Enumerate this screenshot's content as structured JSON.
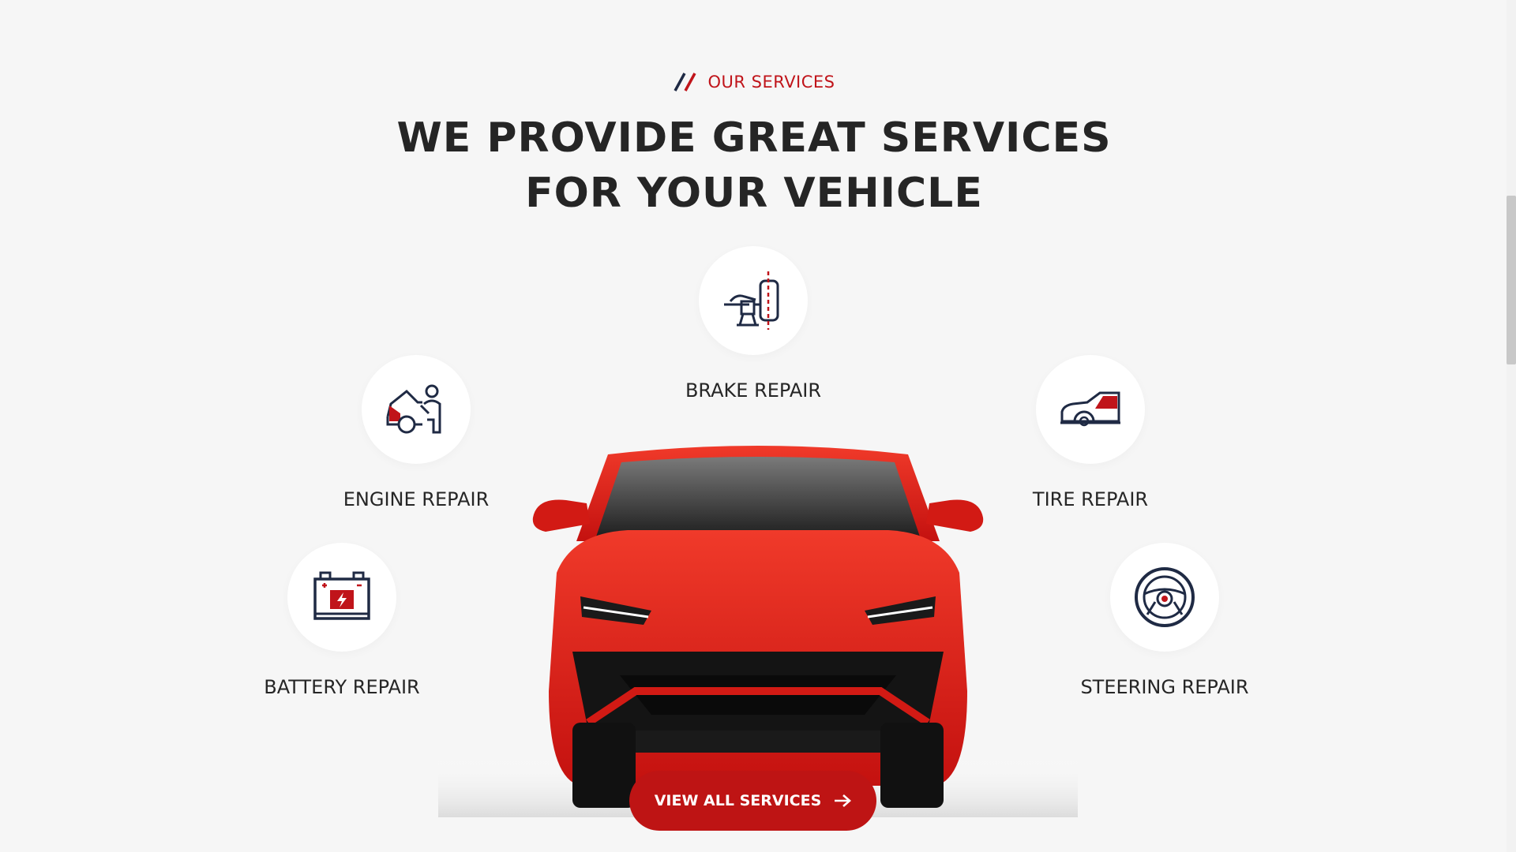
{
  "section": {
    "eyebrow": "OUR SERVICES",
    "title_line1": "WE PROVIDE GREAT SERVICES",
    "title_line2": "FOR YOUR VEHICLE"
  },
  "services": {
    "brake": {
      "label": "BRAKE REPAIR",
      "icon": "brake-icon"
    },
    "engine": {
      "label": "ENGINE REPAIR",
      "icon": "engine-mechanic-icon"
    },
    "tire": {
      "label": "TIRE REPAIR",
      "icon": "car-tire-icon"
    },
    "battery": {
      "label": "BATTERY REPAIR",
      "icon": "battery-icon"
    },
    "steering": {
      "label": "STEERING REPAIR",
      "icon": "steering-wheel-icon"
    }
  },
  "cta": {
    "label": "VIEW ALL SERVICES",
    "icon": "arrow-right-icon"
  },
  "colors": {
    "accent": "#c0141a",
    "navy": "#1f2a44",
    "text": "#252525",
    "background": "#f6f6f6"
  }
}
